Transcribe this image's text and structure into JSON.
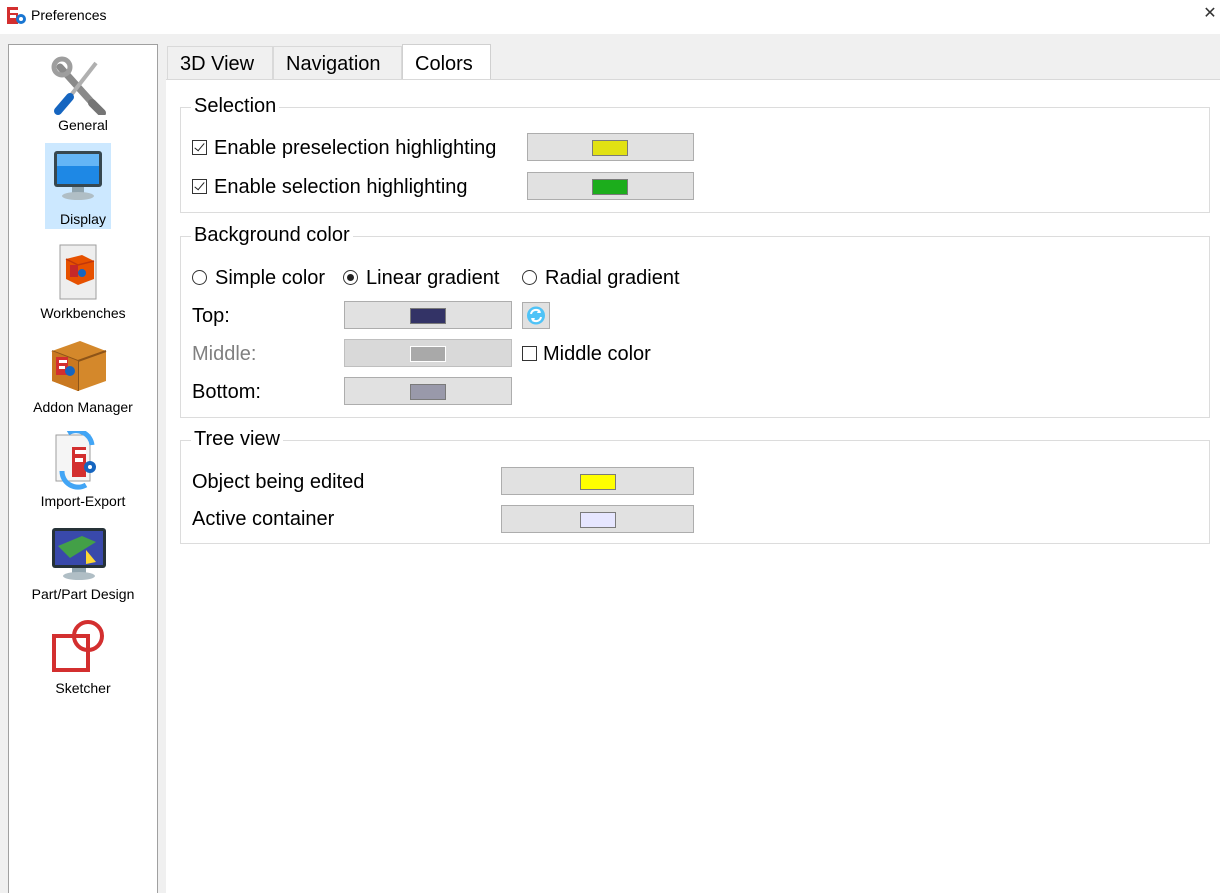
{
  "window": {
    "title": "Preferences",
    "close_glyph": "✕",
    "app_icon": "freecad-icon"
  },
  "sidebar": {
    "items": [
      {
        "label": "General",
        "icon": "tools-icon"
      },
      {
        "label": "Display",
        "icon": "monitor-icon",
        "selected": true
      },
      {
        "label": "Workbenches",
        "icon": "workbench-icon"
      },
      {
        "label": "Addon Manager",
        "icon": "addon-box-icon"
      },
      {
        "label": "Import-Export",
        "icon": "import-export-icon"
      },
      {
        "label": "Part/Part Design",
        "icon": "part-design-icon"
      },
      {
        "label": "Sketcher",
        "icon": "sketcher-icon"
      }
    ]
  },
  "tabs": [
    {
      "label": "3D View"
    },
    {
      "label": "Navigation"
    },
    {
      "label": "Colors",
      "active": true
    }
  ],
  "selection": {
    "title": "Selection",
    "preselection_label": "Enable preselection highlighting",
    "preselection_checked": true,
    "preselection_color": "#e1e113",
    "selection_label": "Enable selection highlighting",
    "selection_checked": true,
    "selection_color": "#1cad1c"
  },
  "background": {
    "title": "Background color",
    "modes": [
      {
        "label": "Simple color",
        "checked": false
      },
      {
        "label": "Linear gradient",
        "checked": true
      },
      {
        "label": "Radial gradient",
        "checked": false
      }
    ],
    "top_label": "Top:",
    "top_color": "#333366",
    "middle_label": "Middle:",
    "middle_color": "#a9a9a9",
    "middle_enabled": false,
    "middle_checkbox_label": "Middle color",
    "middle_checked": false,
    "bottom_label": "Bottom:",
    "bottom_color": "#9999aa",
    "swap_icon": "refresh-icon"
  },
  "tree_view": {
    "title": "Tree view",
    "edited_label": "Object being edited",
    "edited_color": "#ffff00",
    "active_label": "Active container",
    "active_color": "#e6e6ff"
  }
}
